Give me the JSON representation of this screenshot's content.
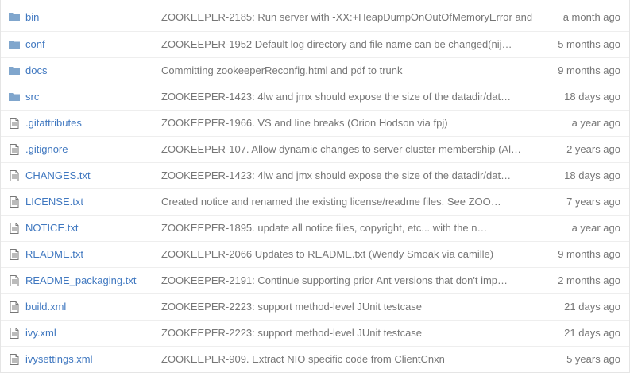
{
  "accent_color": "#4078c0",
  "muted_color": "#767676",
  "folder_icon_color": "#80a6cd",
  "files": [
    {
      "name": "bin",
      "type": "folder",
      "message": "ZOOKEEPER-2185: Run server with -XX:+HeapDumpOnOutOfMemoryError and",
      "age": "a month ago"
    },
    {
      "name": "conf",
      "type": "folder",
      "message": "ZOOKEEPER-1952 Default log directory and file name can be changed(nij…",
      "age": "5 months ago"
    },
    {
      "name": "docs",
      "type": "folder",
      "message": "Committing zookeeperReconfig.html and pdf to trunk",
      "age": "9 months ago"
    },
    {
      "name": "src",
      "type": "folder",
      "message": "ZOOKEEPER-1423: 4lw and jmx should expose the size of the datadir/dat…",
      "age": "18 days ago"
    },
    {
      "name": ".gitattributes",
      "type": "file",
      "message": "ZOOKEEPER-1966. VS and line breaks (Orion Hodson via fpj)",
      "age": "a year ago"
    },
    {
      "name": ".gitignore",
      "type": "file",
      "message": "ZOOKEEPER-107. Allow dynamic changes to server cluster membership (Al…",
      "age": "2 years ago"
    },
    {
      "name": "CHANGES.txt",
      "type": "file",
      "message": "ZOOKEEPER-1423: 4lw and jmx should expose the size of the datadir/dat…",
      "age": "18 days ago"
    },
    {
      "name": "LICENSE.txt",
      "type": "file",
      "message": "Created notice and renamed the existing license/readme files. See ZOO…",
      "age": "7 years ago"
    },
    {
      "name": "NOTICE.txt",
      "type": "file",
      "message": "ZOOKEEPER-1895. update all notice files, copyright, etc... with the n…",
      "age": "a year ago"
    },
    {
      "name": "README.txt",
      "type": "file",
      "message": "ZOOKEEPER-2066 Updates to README.txt (Wendy Smoak via camille)",
      "age": "9 months ago"
    },
    {
      "name": "README_packaging.txt",
      "type": "file",
      "message": "ZOOKEEPER-2191: Continue supporting prior Ant versions that don't imp…",
      "age": "2 months ago"
    },
    {
      "name": "build.xml",
      "type": "file",
      "message": "ZOOKEEPER-2223: support method-level JUnit testcase",
      "age": "21 days ago"
    },
    {
      "name": "ivy.xml",
      "type": "file",
      "message": "ZOOKEEPER-2223: support method-level JUnit testcase",
      "age": "21 days ago"
    },
    {
      "name": "ivysettings.xml",
      "type": "file",
      "message": "ZOOKEEPER-909. Extract NIO specific code from ClientCnxn",
      "age": "5 years ago"
    }
  ]
}
